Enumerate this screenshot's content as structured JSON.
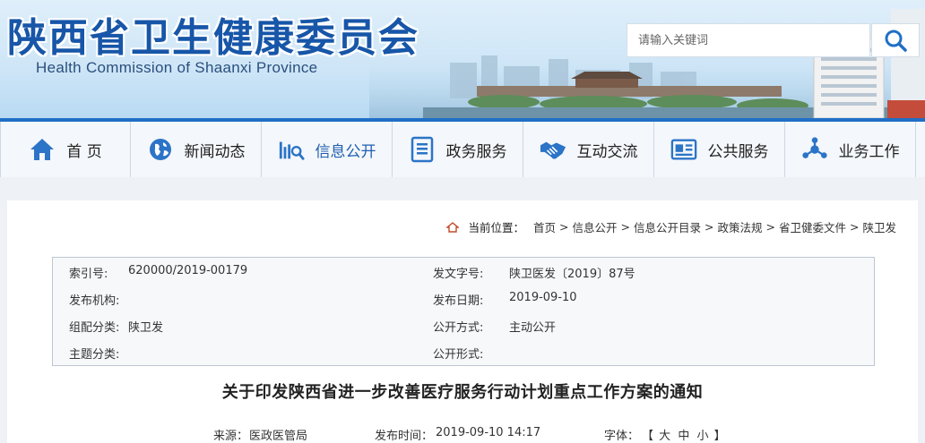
{
  "header": {
    "title_cn": "陕西省卫生健康委员会",
    "title_en": "Health Commission of Shaanxi Province",
    "search_placeholder": "请输入关键词"
  },
  "nav": {
    "items": [
      {
        "label": "首 页",
        "icon": "home-icon"
      },
      {
        "label": "新闻动态",
        "icon": "globe-icon"
      },
      {
        "label": "信息公开",
        "icon": "chart-search-icon",
        "active": true
      },
      {
        "label": "政务服务",
        "icon": "document-list-icon"
      },
      {
        "label": "互动交流",
        "icon": "handshake-icon"
      },
      {
        "label": "公共服务",
        "icon": "id-card-icon"
      },
      {
        "label": "业务工作",
        "icon": "network-icon"
      }
    ]
  },
  "breadcrumb": {
    "label": "当前位置：",
    "items": [
      "首页",
      "信息公开",
      "信息公开目录",
      "政策法规",
      "省卫健委文件",
      "陕卫发"
    ]
  },
  "meta": {
    "index_no_label": "索引号:",
    "index_no": "620000/2019-00179",
    "doc_no_label": "发文字号:",
    "doc_no": "陕卫医发〔2019〕87号",
    "publisher_label": "发布机构:",
    "publisher": "",
    "pub_date_label": "发布日期:",
    "pub_date": "2019-09-10",
    "category_label": "组配分类:",
    "category": "陕卫发",
    "open_mode_label": "公开方式:",
    "open_mode": "主动公开",
    "topic_label": "主题分类:",
    "topic": "",
    "open_form_label": "公开形式:",
    "open_form": ""
  },
  "article": {
    "title": "关于印发陕西省进一步改善医疗服务行动计划重点工作方案的通知",
    "source_label": "来源：",
    "source": "医政医管局",
    "pub_time_label": "发布时间：",
    "pub_time": "2019-09-10 14:17",
    "font_label": "字体：",
    "font_open": "【",
    "font_large": "大",
    "font_medium": "中",
    "font_small": "小",
    "font_close": "】"
  },
  "colors": {
    "brand_blue": "#1f6fc6",
    "title_blue": "#1756a8",
    "icon_blue": "#2b74c7"
  }
}
